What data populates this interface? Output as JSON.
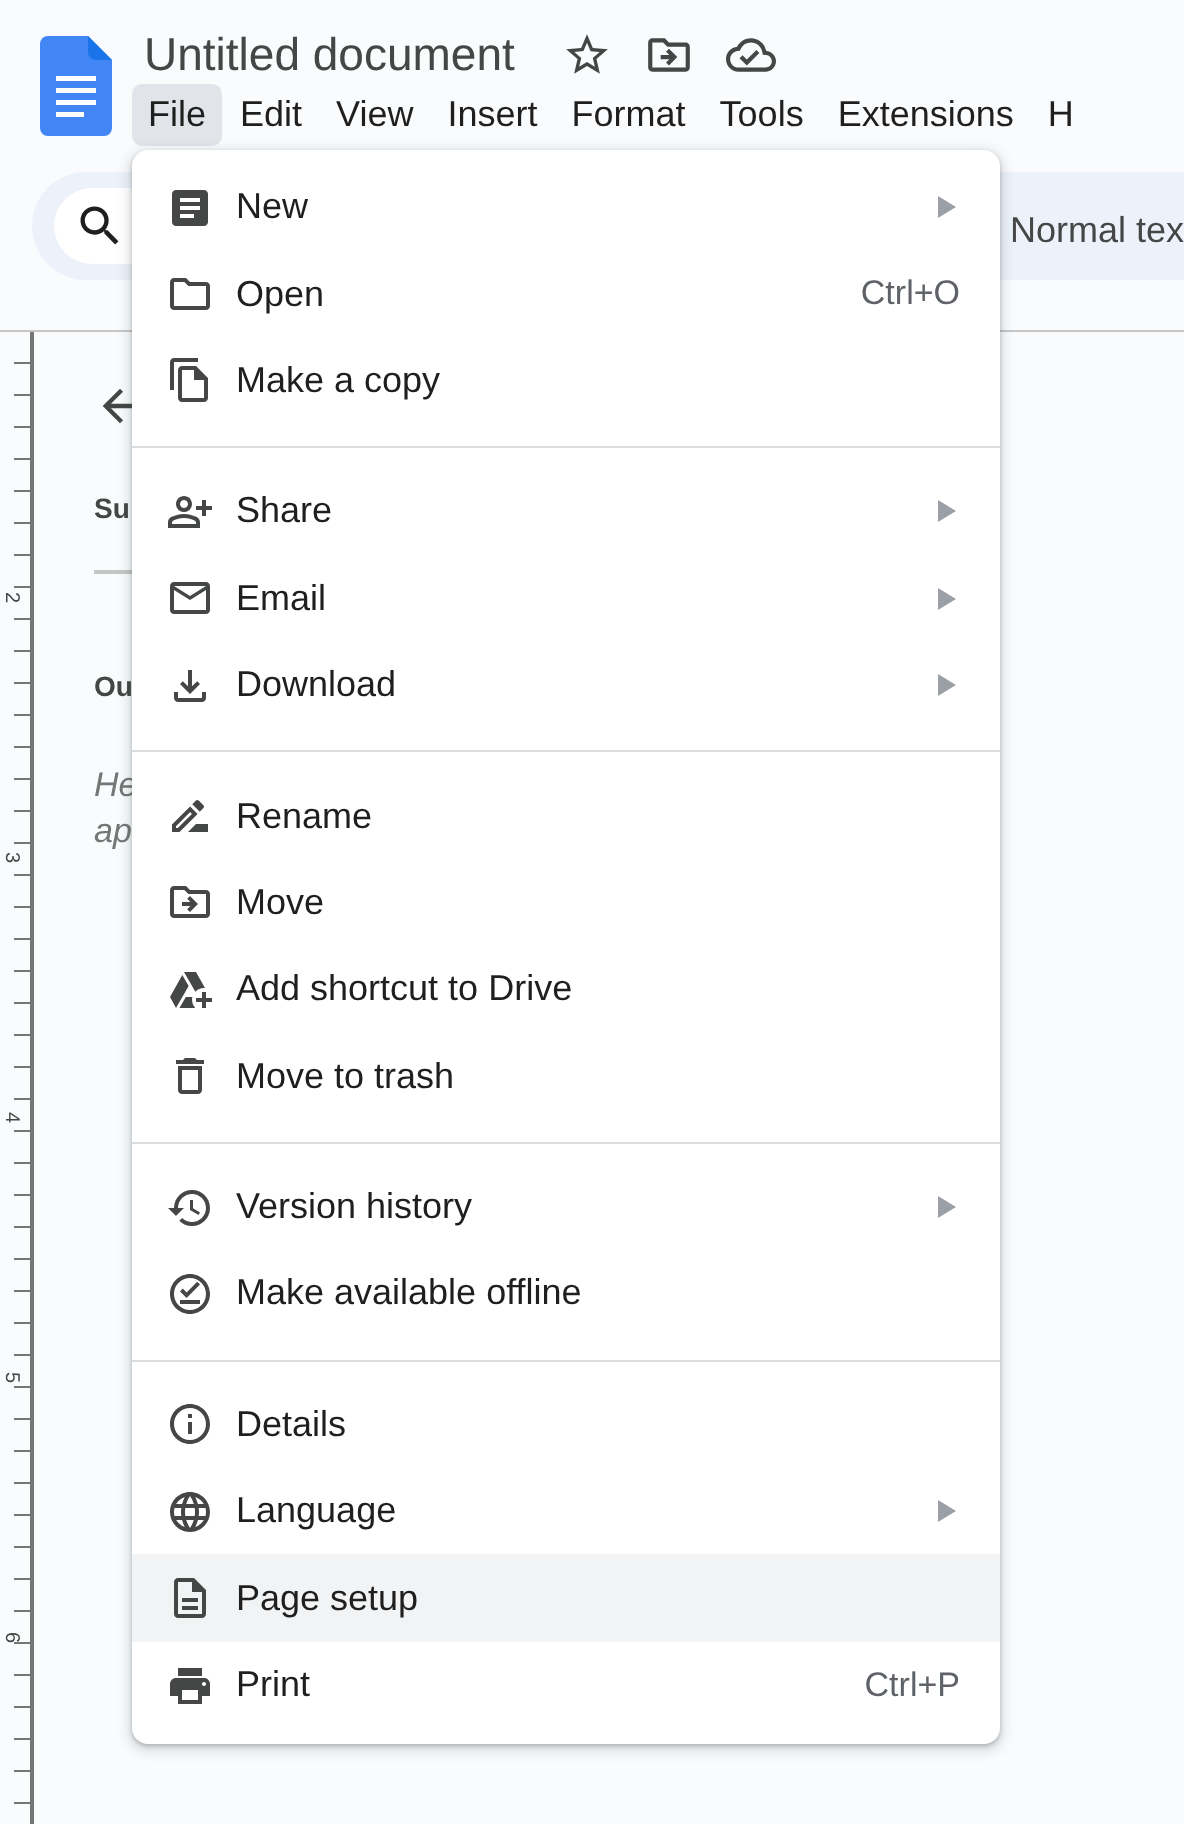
{
  "document": {
    "title": "Untitled document"
  },
  "menu_bar": [
    {
      "label": "File",
      "selected": true
    },
    {
      "label": "Edit",
      "selected": false
    },
    {
      "label": "View",
      "selected": false
    },
    {
      "label": "Insert",
      "selected": false
    },
    {
      "label": "Format",
      "selected": false
    },
    {
      "label": "Tools",
      "selected": false
    },
    {
      "label": "Extensions",
      "selected": false
    },
    {
      "label": "H",
      "selected": false
    }
  ],
  "toolbar": {
    "style_select": "Normal tex"
  },
  "ruler": {
    "labels": [
      "2",
      "3",
      "4",
      "5",
      "6"
    ]
  },
  "outline_panel": {
    "summary_label": "Su",
    "outline_label": "Ou",
    "hint_lines": [
      "He",
      "ap"
    ]
  },
  "file_menu": {
    "sections": [
      [
        {
          "label": "New",
          "submenu": true,
          "selected": false
        },
        {
          "label": "Open",
          "shortcut": "Ctrl+O",
          "submenu": false,
          "selected": false
        },
        {
          "label": "Make a copy",
          "submenu": false,
          "selected": false
        }
      ],
      [
        {
          "label": "Share",
          "submenu": true,
          "selected": false
        },
        {
          "label": "Email",
          "submenu": true,
          "selected": false
        },
        {
          "label": "Download",
          "submenu": true,
          "selected": false
        }
      ],
      [
        {
          "label": "Rename",
          "submenu": false,
          "selected": false
        },
        {
          "label": "Move",
          "submenu": false,
          "selected": false
        },
        {
          "label": "Add shortcut to Drive",
          "submenu": false,
          "selected": false
        },
        {
          "label": "Move to trash",
          "submenu": false,
          "selected": false
        }
      ],
      [
        {
          "label": "Version history",
          "submenu": true,
          "selected": false
        },
        {
          "label": "Make available offline",
          "submenu": false,
          "selected": false
        }
      ],
      [
        {
          "label": "Details",
          "submenu": false,
          "selected": false
        },
        {
          "label": "Language",
          "submenu": true,
          "selected": false
        },
        {
          "label": "Page setup",
          "submenu": false,
          "selected": true
        },
        {
          "label": "Print",
          "shortcut": "Ctrl+P",
          "submenu": false,
          "selected": false
        }
      ]
    ]
  }
}
